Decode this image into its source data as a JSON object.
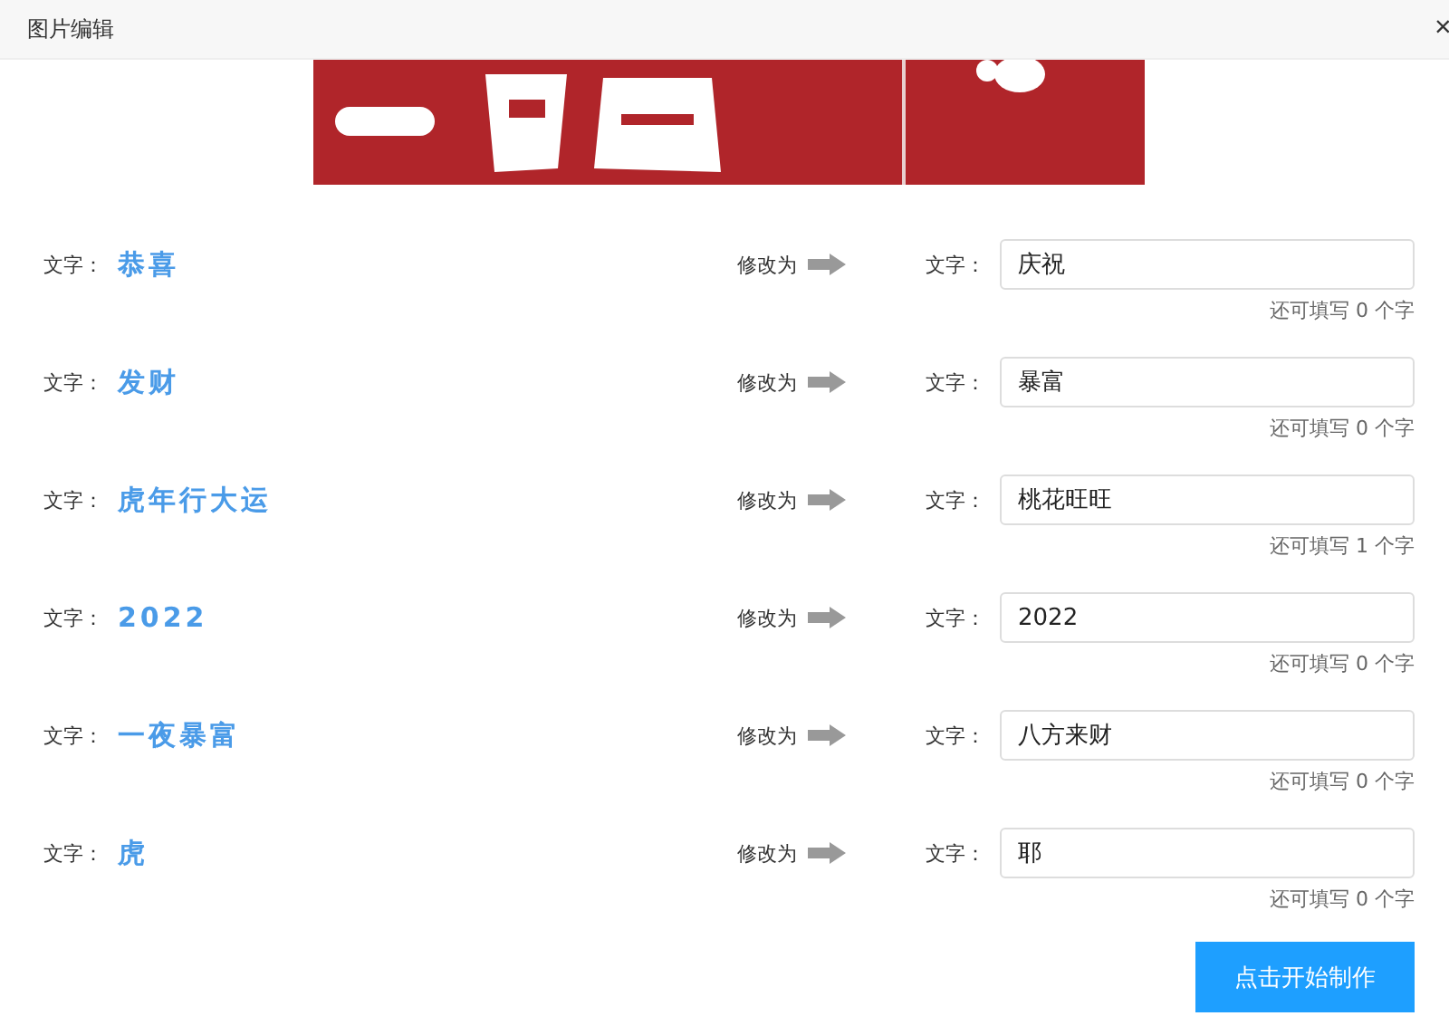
{
  "dialog": {
    "title": "图片编辑",
    "close": "×"
  },
  "rows": [
    {
      "label": "文字：",
      "source": "恭喜",
      "change_label": "修改为",
      "target_label": "文字：",
      "value": "庆祝",
      "hint": "还可填写 0 个字"
    },
    {
      "label": "文字：",
      "source": "发财",
      "change_label": "修改为",
      "target_label": "文字：",
      "value": "暴富",
      "hint": "还可填写 0 个字"
    },
    {
      "label": "文字：",
      "source": "虎年行大运",
      "change_label": "修改为",
      "target_label": "文字：",
      "value": "桃花旺旺",
      "hint": "还可填写 1 个字"
    },
    {
      "label": "文字：",
      "source": "2022",
      "change_label": "修改为",
      "target_label": "文字：",
      "value": "2022",
      "hint": "还可填写 0 个字"
    },
    {
      "label": "文字：",
      "source": "一夜暴富",
      "change_label": "修改为",
      "target_label": "文字：",
      "value": "八方来财",
      "hint": "还可填写 0 个字"
    },
    {
      "label": "文字：",
      "source": "虎",
      "change_label": "修改为",
      "target_label": "文字：",
      "value": "耶",
      "hint": "还可填写 0 个字"
    }
  ],
  "submit": "点击开始制作"
}
